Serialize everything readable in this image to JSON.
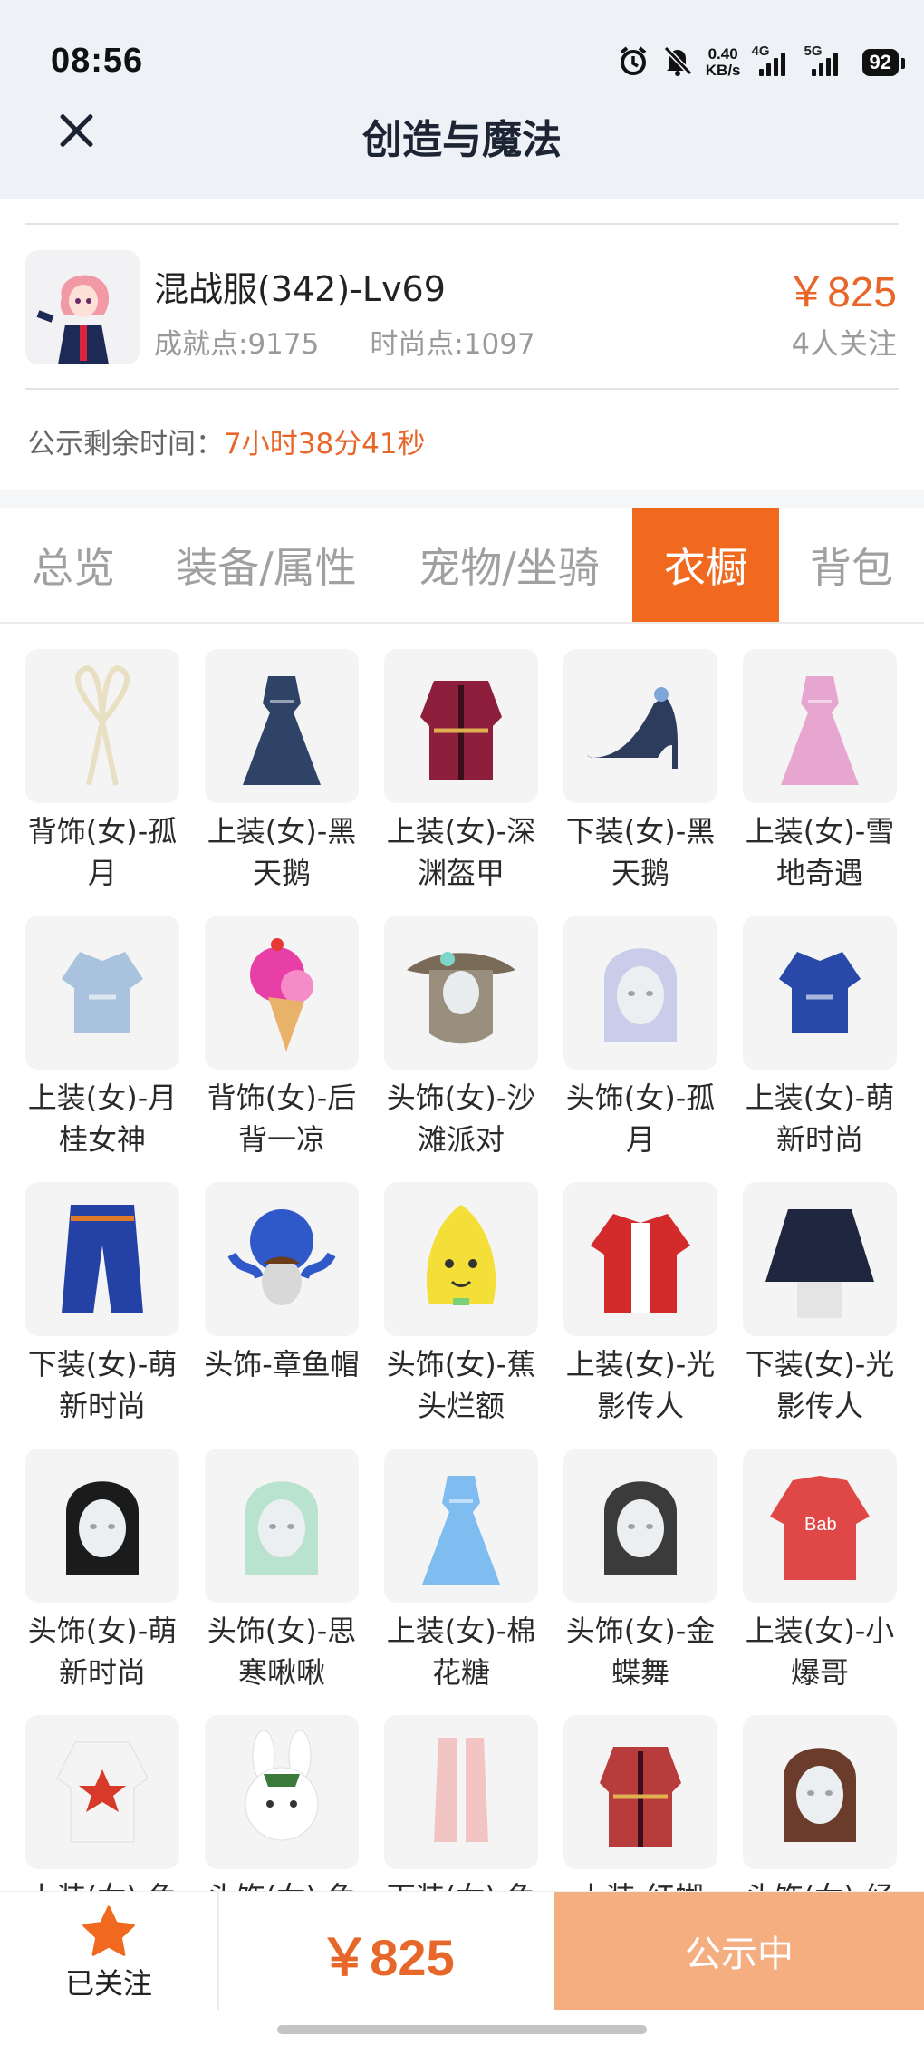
{
  "status_bar": {
    "time": "08:56",
    "net_speed_value": "0.40",
    "net_speed_unit": "KB/s",
    "signal_1_tag": "4G",
    "signal_2_tag": "5G",
    "battery": "92",
    "icons": [
      "alarm-icon",
      "mute-bell-icon",
      "signal-icon",
      "battery-icon"
    ]
  },
  "header": {
    "title": "创造与魔法"
  },
  "item": {
    "name": "混战服(342)-Lv69",
    "achievement_points": "成就点:9175",
    "fashion_points": "时尚点:1097",
    "price": "￥825",
    "followers": "4人关注",
    "countdown_label": "公示剩余时间：",
    "countdown_value": "7小时38分41秒"
  },
  "tabs": [
    {
      "label": "总览",
      "active": false
    },
    {
      "label": "装备/属性",
      "active": false
    },
    {
      "label": "宠物/坐骑",
      "active": false
    },
    {
      "label": "衣橱",
      "active": true
    },
    {
      "label": "背包",
      "active": false
    }
  ],
  "wardrobe": [
    {
      "name": "背饰(女)-孤月",
      "icon": "back-ornament-ribbon-icon",
      "color": "#e9e0c4"
    },
    {
      "name": "上装(女)-黑天鹅",
      "icon": "dress-icon",
      "color": "#2f4367"
    },
    {
      "name": "上装(女)-深渊盔甲",
      "icon": "armor-icon",
      "color": "#8d1f3c"
    },
    {
      "name": "下装(女)-黑天鹅",
      "icon": "high-heel-icon",
      "color": "#2d3b5c"
    },
    {
      "name": "上装(女)-雪地奇遇",
      "icon": "dress-icon",
      "color": "#e7a6cf"
    },
    {
      "name": "上装(女)-月桂女神",
      "icon": "top-icon",
      "color": "#a9c3df"
    },
    {
      "name": "背饰(女)-后背一凉",
      "icon": "ice-cream-icon",
      "color": "#e83fa6"
    },
    {
      "name": "头饰(女)-沙滩派对",
      "icon": "hat-hair-icon",
      "color": "#9a8e7c"
    },
    {
      "name": "头饰(女)-孤月",
      "icon": "hair-icon",
      "color": "#c9cde9"
    },
    {
      "name": "上装(女)-萌新时尚",
      "icon": "top-icon",
      "color": "#2949a8"
    },
    {
      "name": "下装(女)-萌新时尚",
      "icon": "pants-icon",
      "color": "#2442a5"
    },
    {
      "name": "头饰-章鱼帽",
      "icon": "octopus-hat-icon",
      "color": "#2f58c8"
    },
    {
      "name": "头饰(女)-蕉头烂额",
      "icon": "banana-hat-icon",
      "color": "#f4de38"
    },
    {
      "name": "上装(女)-光影传人",
      "icon": "jacket-icon",
      "color": "#d32b2b"
    },
    {
      "name": "下装(女)-光影传人",
      "icon": "skirt-icon",
      "color": "#1f2740"
    },
    {
      "name": "头饰(女)-萌新时尚",
      "icon": "hair-icon",
      "color": "#1b1b1b"
    },
    {
      "name": "头饰(女)-思寒啾啾",
      "icon": "hair-icon",
      "color": "#b9e2cf"
    },
    {
      "name": "上装(女)-棉花糖",
      "icon": "dress-icon",
      "color": "#7fbdf0"
    },
    {
      "name": "头饰(女)-金蝶舞",
      "icon": "hair-icon",
      "color": "#3b3b3b"
    },
    {
      "name": "上装(女)-小爆哥",
      "icon": "hoodie-icon",
      "color": "#e04848"
    },
    {
      "name": "上装(女)-兔",
      "icon": "bunny-suit-icon",
      "color": "#f4f4f4"
    },
    {
      "name": "头饰(女)-兔",
      "icon": "bunny-head-icon",
      "color": "#ffffff"
    },
    {
      "name": "下装(女)-兔",
      "icon": "boots-icon",
      "color": "#f3c4c4"
    },
    {
      "name": "上装-红蝴",
      "icon": "armor-icon",
      "color": "#b93c3c"
    },
    {
      "name": "头饰(女)-经",
      "icon": "hair-icon",
      "color": "#6b3b2c"
    }
  ],
  "bottom_bar": {
    "follow_label": "已关注",
    "price": "￥825",
    "status_button": "公示中"
  },
  "colors": {
    "accent": "#f0691f",
    "price": "#e7672a",
    "status_button": "#f5ae80",
    "header_bg": "#eef2f7"
  }
}
